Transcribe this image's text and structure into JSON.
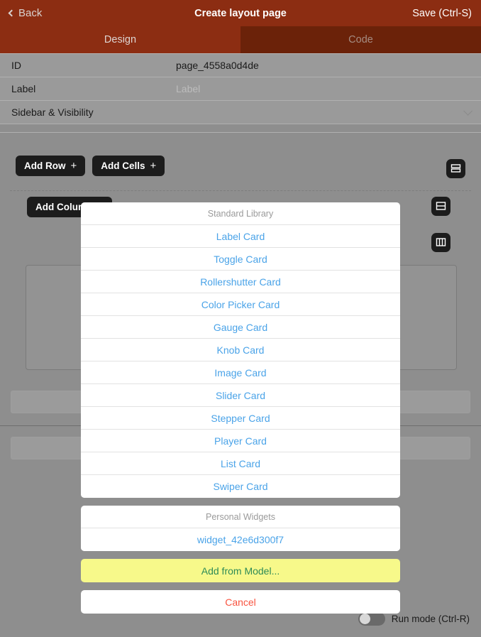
{
  "header": {
    "back_label": "Back",
    "title": "Create layout page",
    "save_label": "Save (Ctrl-S)"
  },
  "tabs": [
    {
      "label": "Design",
      "active": true
    },
    {
      "label": "Code",
      "active": false
    }
  ],
  "properties": [
    {
      "label": "ID",
      "value": "page_4558a0d4de",
      "is_placeholder": false
    },
    {
      "label": "Label",
      "value": "Label",
      "is_placeholder": true
    },
    {
      "label": "Sidebar & Visibility",
      "value": "",
      "is_placeholder": false
    }
  ],
  "toolbar": {
    "add_row_label": "Add Row",
    "add_cells_label": "Add Cells",
    "add_column_label": "Add Column",
    "plus_glyph": "+"
  },
  "canvas": {
    "run_mode_label": "Run mode (Ctrl-R)",
    "run_mode_on": false
  },
  "sheet": {
    "standard_header": "Standard Library",
    "standard_items": [
      "Label Card",
      "Toggle Card",
      "Rollershutter Card",
      "Color Picker Card",
      "Gauge Card",
      "Knob Card",
      "Image Card",
      "Slider Card",
      "Stepper Card",
      "Player Card",
      "List Card",
      "Swiper Card"
    ],
    "personal_header": "Personal Widgets",
    "personal_items": [
      "widget_42e6d300f7"
    ],
    "add_from_model_label": "Add from Model...",
    "cancel_label": "Cancel"
  },
  "colors": {
    "header_bg": "#8c2d12",
    "tab_inactive_bg": "#6b2209",
    "page_bg": "#8e8e8e",
    "link_blue": "#4aa3e8",
    "model_yellow": "#f7f98a",
    "model_green": "#2e8b57",
    "cancel_red": "#f8533f"
  }
}
